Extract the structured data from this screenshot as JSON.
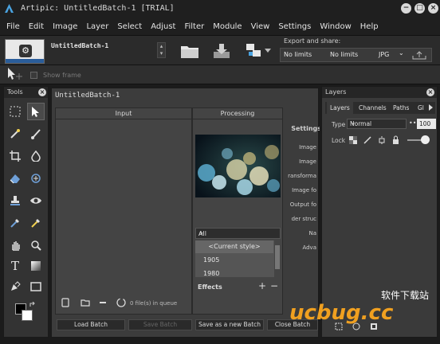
{
  "window": {
    "title": "Artipic: UntitledBatch-1 [TRIAL]"
  },
  "menu": [
    "File",
    "Edit",
    "Image",
    "Layer",
    "Select",
    "Adjust",
    "Filter",
    "Module",
    "View",
    "Settings",
    "Window",
    "Help"
  ],
  "batch": {
    "name": "UntitledBatch-1"
  },
  "export": {
    "label": "Export and share:",
    "width": "No limits",
    "height": "No limits",
    "format": "JPG"
  },
  "options": {
    "show_frame_label": "Show frame"
  },
  "tools_panel": {
    "title": "Tools"
  },
  "main": {
    "title": "UntitledBatch-1",
    "input_header": "Input",
    "processing_header": "Processing",
    "queue_text": "0 file(s) in queue",
    "style_selected": "All",
    "styles": [
      "<Current style>",
      "1905",
      "1980"
    ],
    "effects_label": "Effects",
    "settings": [
      "Settings",
      "Image",
      "Image",
      "ransforma",
      "Image fo",
      "Output fo",
      "der struc",
      "Na",
      "Adva"
    ],
    "buttons": {
      "load": "Load Batch",
      "save": "Save Batch",
      "save_new": "Save as a new Batch",
      "close": "Close Batch"
    }
  },
  "layers_panel": {
    "title": "Layers",
    "tabs": [
      "Layers",
      "Channels",
      "Paths",
      "Gl"
    ],
    "type_label": "Type",
    "blend_mode": "Normal",
    "opacity": "100",
    "lock_label": "Lock"
  },
  "watermark": {
    "text": "ucbug.cc",
    "cn": "软件下载站"
  },
  "colors": {
    "accent": "#2a5d9a",
    "watermark": "#f0a020"
  }
}
